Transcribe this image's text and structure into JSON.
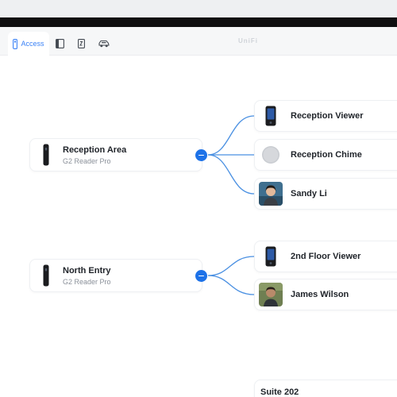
{
  "toolbar": {
    "tabs": [
      {
        "label": "Access",
        "icon": "door-reader-icon",
        "active": true
      },
      {
        "label": "",
        "icon": "book-icon"
      },
      {
        "label": "",
        "icon": "phone-sheet-icon"
      },
      {
        "label": "",
        "icon": "car-icon"
      }
    ],
    "brand": "UniFi",
    "accent": "#3b82f6"
  },
  "topology": {
    "groups": [
      {
        "source": {
          "name": "Reception Area",
          "model": "G2 Reader Pro",
          "icon": "reader-device-icon"
        },
        "targets": [
          {
            "name": "Reception Viewer",
            "icon": "viewer-device-icon"
          },
          {
            "name": "Reception Chime",
            "icon": "chime-device-icon"
          },
          {
            "name": "Sandy Li",
            "icon": "user-avatar"
          }
        ]
      },
      {
        "source": {
          "name": "North Entry",
          "model": "G2 Reader Pro",
          "icon": "reader-device-icon"
        },
        "targets": [
          {
            "name": "2nd Floor Viewer",
            "icon": "viewer-device-icon"
          },
          {
            "name": "James Wilson",
            "icon": "user-avatar"
          }
        ]
      }
    ],
    "partial_item": "Suite 202",
    "link_color": "#4a90e2",
    "collapse_color": "#1d72e8"
  }
}
